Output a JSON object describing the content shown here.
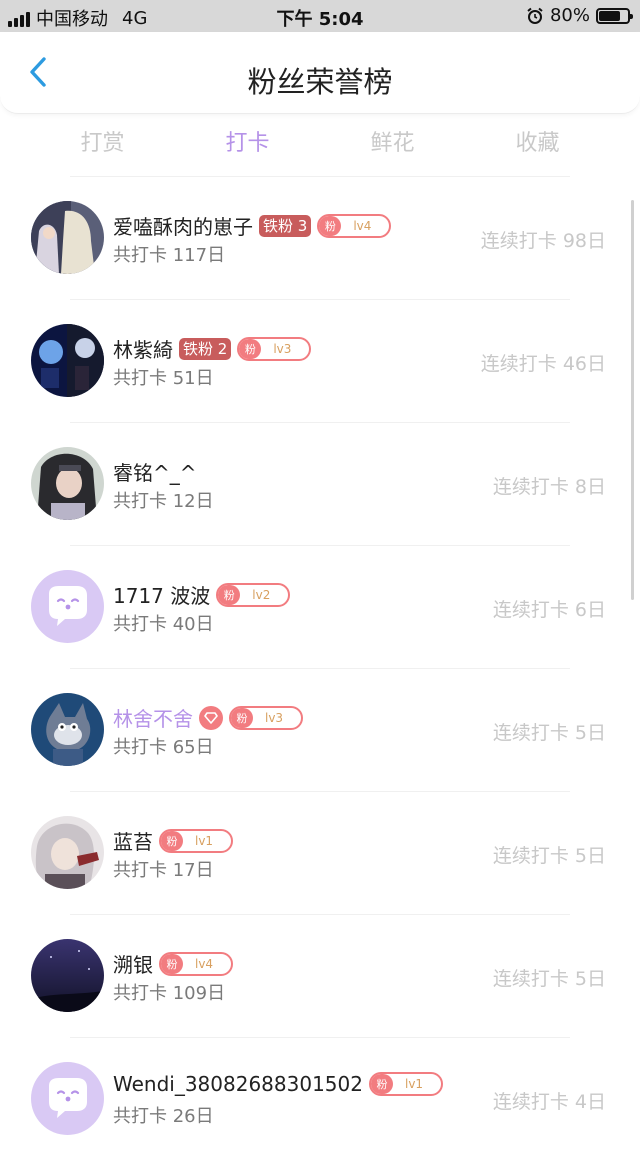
{
  "status": {
    "carrier": "中国移动",
    "network": "4G",
    "time": "下午 5:04",
    "battery": "80%",
    "battery_level": 0.8
  },
  "header": {
    "title": "粉丝荣誉榜",
    "back_icon": "chevron-left-icon"
  },
  "tabs": [
    {
      "label": "打赏"
    },
    {
      "label": "打卡",
      "active": true
    },
    {
      "label": "鲜花"
    },
    {
      "label": "收藏"
    }
  ],
  "rows": [
    {
      "name": "爱嗑酥肉的崽子",
      "iron": "铁粉 3",
      "fan": "粉",
      "level": "lv4",
      "total": "共打卡 117日",
      "streak": "连续打卡 98日"
    },
    {
      "name": "林紫綺",
      "iron": "铁粉 2",
      "fan": "粉",
      "level": "lv3",
      "total": "共打卡 51日",
      "streak": "连续打卡 46日"
    },
    {
      "name": "睿铭^_^",
      "total": "共打卡 12日",
      "streak": "连续打卡 8日"
    },
    {
      "name": "1717 波波",
      "fan": "粉",
      "level": "lv2",
      "total": "共打卡 40日",
      "streak": "连续打卡 6日"
    },
    {
      "name": "林舍不舍",
      "fan": "粉",
      "level": "lv3",
      "total": "共打卡 65日",
      "streak": "连续打卡 5日"
    },
    {
      "name": "蓝苔",
      "fan": "粉",
      "level": "lv1",
      "total": "共打卡 17日",
      "streak": "连续打卡 5日"
    },
    {
      "name": "溯银",
      "fan": "粉",
      "level": "lv4",
      "total": "共打卡 109日",
      "streak": "连续打卡 5日"
    },
    {
      "name": "Wendi_38082688301502",
      "fan": "粉",
      "level": "lv1",
      "total": "共打卡 26日",
      "streak": "连续打卡 4日"
    }
  ],
  "colors": {
    "accent": "#b592e8",
    "fan_badge": "#f27c80",
    "iron_badge": "#c85c5c"
  }
}
